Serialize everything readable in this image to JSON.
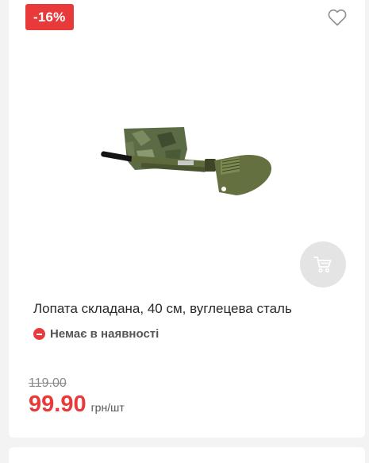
{
  "product": {
    "discount_badge": "-16%",
    "title": "Лопата складана, 40 см, вуглецева сталь",
    "stock_status": "Немає в наявності",
    "old_price": "119.00",
    "price": "99.90",
    "unit": "грн/шт",
    "image_name": "folding-shovel-image"
  },
  "icons": {
    "wishlist": "heart-icon",
    "cart": "cart-icon",
    "stock": "minus-circle-icon"
  },
  "colors": {
    "accent": "#e83a3a",
    "cart_button_bg": "#e4e4e4",
    "page_bg": "#f3f3f3"
  }
}
